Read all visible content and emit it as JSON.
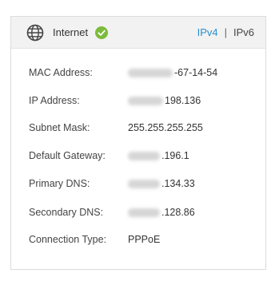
{
  "header": {
    "title": "Internet",
    "globe_icon": "globe-icon",
    "status_icon": "check-circle-icon",
    "status_color": "#7cbb3c",
    "tabs": [
      {
        "label": "IPv4",
        "active": true
      },
      {
        "label": "IPv6",
        "active": false
      }
    ],
    "separator": "|",
    "accent_color": "#2a8fd0"
  },
  "fields": [
    {
      "label": "MAC Address:",
      "value_suffix": "-67-14-54",
      "redacted": true
    },
    {
      "label": "IP Address:",
      "value_suffix": "198.136",
      "redacted": true
    },
    {
      "label": "Subnet Mask:",
      "value_suffix": "255.255.255.255",
      "redacted": false
    },
    {
      "label": "Default Gateway:",
      "value_suffix": ".196.1",
      "redacted": true
    },
    {
      "label": "Primary DNS:",
      "value_suffix": ".134.33",
      "redacted": true
    },
    {
      "label": "Secondary DNS:",
      "value_suffix": ".128.86",
      "redacted": true
    },
    {
      "label": "Connection Type:",
      "value_suffix": "PPPoE",
      "redacted": false
    }
  ]
}
